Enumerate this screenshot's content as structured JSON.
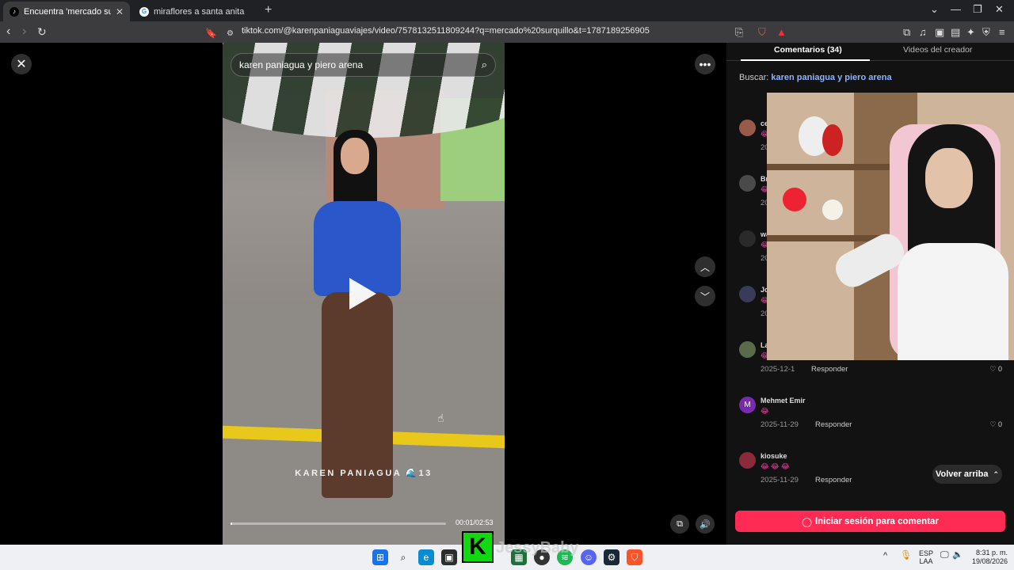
{
  "browser": {
    "tabs": [
      {
        "title": "Encuentra 'mercado surquillo' en",
        "active": true
      },
      {
        "title": "miraflores a santa anita - Buscar con",
        "active": false
      }
    ],
    "url": "tiktok.com/@karenpaniaguaviajes/video/7578132511809244?q=mercado%20surquillo&t=1787189256905"
  },
  "video": {
    "search_query": "karen paniagua y piero arena",
    "caption": "KAREN PANIAGUA 🌊13",
    "time": "00:01/02:53",
    "progress": 0.006
  },
  "panel": {
    "tab_comments": "Comentarios (34)",
    "tab_creator": "Videos del creador",
    "buscar_label": "Buscar:",
    "buscar_query": "karen paniagua y piero arena",
    "comments": [
      {
        "name": "ce",
        "emoji": "😂",
        "date": "20",
        "reply": "",
        "likes": "",
        "avatar_color": "#9a5a4a"
      },
      {
        "name": "Br",
        "emoji": "😂",
        "date": "20",
        "reply": "",
        "likes": "",
        "avatar_color": "#4a4a4a"
      },
      {
        "name": "wa",
        "emoji": "😂",
        "date": "20",
        "reply": "",
        "likes": "",
        "avatar_color": "#2a2a2a"
      },
      {
        "name": "Jo",
        "emoji": "😂",
        "date": "20",
        "reply": "",
        "likes": "",
        "avatar_color": "#3a3a5a"
      },
      {
        "name": "La",
        "emoji": "😂",
        "date": "2025-12-1",
        "reply": "Responder",
        "likes": "♡ 0",
        "avatar_color": "#5a6a4a"
      },
      {
        "name": "Mehmet Emir",
        "emoji": "😂",
        "date": "2025-11-29",
        "reply": "Responder",
        "likes": "♡ 0",
        "avatar_color": "#7a2ab0",
        "initial": "M"
      },
      {
        "name": "kiosuke",
        "emoji": "😂 😂 😂",
        "date": "2025-11-29",
        "reply": "Responder",
        "likes": "",
        "avatar_color": "#8a2a3a"
      }
    ],
    "scroll_top": "Volver arriba",
    "login_button": "Iniciar sesión para comentar"
  },
  "overlay": {
    "logo_letter": "K",
    "streamer_name": "JessyBaby"
  },
  "taskbar": {
    "lang_top": "ESP",
    "lang_bottom": "LAA",
    "time": "8:31 p. m.",
    "date": "19/08/2026"
  },
  "colors": {
    "accent": "#fe2c55",
    "link": "#8cb4ff"
  }
}
